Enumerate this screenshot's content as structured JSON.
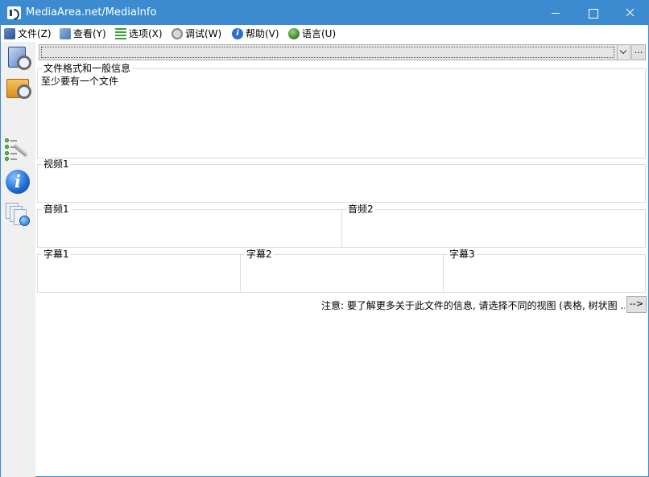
{
  "window": {
    "title": "MediaArea.net/MediaInfo"
  },
  "menu": {
    "items": [
      {
        "label": "文件(Z)",
        "icon": "file-icon"
      },
      {
        "label": "查看(Y)",
        "icon": "view-icon"
      },
      {
        "label": "选项(X)",
        "icon": "options-icon"
      },
      {
        "label": "调试(W)",
        "icon": "debug-icon"
      },
      {
        "label": "帮助(V)",
        "icon": "help-icon"
      },
      {
        "label": "语言(U)",
        "icon": "language-icon"
      }
    ]
  },
  "toolbar": {
    "buttons": [
      {
        "icon": "open-file-icon"
      },
      {
        "icon": "open-folder-icon"
      },
      {
        "icon": "preferences-icon"
      },
      {
        "icon": "about-icon"
      },
      {
        "icon": "website-icon"
      }
    ]
  },
  "file_selector": {
    "value": "",
    "browse_label": "..."
  },
  "sections": {
    "general": {
      "title": "文件格式和一般信息",
      "content": "至少要有一个文件"
    },
    "video1": {
      "title": "视频1"
    },
    "audio1": {
      "title": "音频1"
    },
    "audio2": {
      "title": "音频2"
    },
    "text1": {
      "title": "字幕1"
    },
    "text2": {
      "title": "字幕2"
    },
    "text3": {
      "title": "字幕3"
    }
  },
  "footer": {
    "note": "注意: 要了解更多关于此文件的信息, 请选择不同的视图 (表格, 树状图 ...)",
    "next_label": "-->"
  }
}
